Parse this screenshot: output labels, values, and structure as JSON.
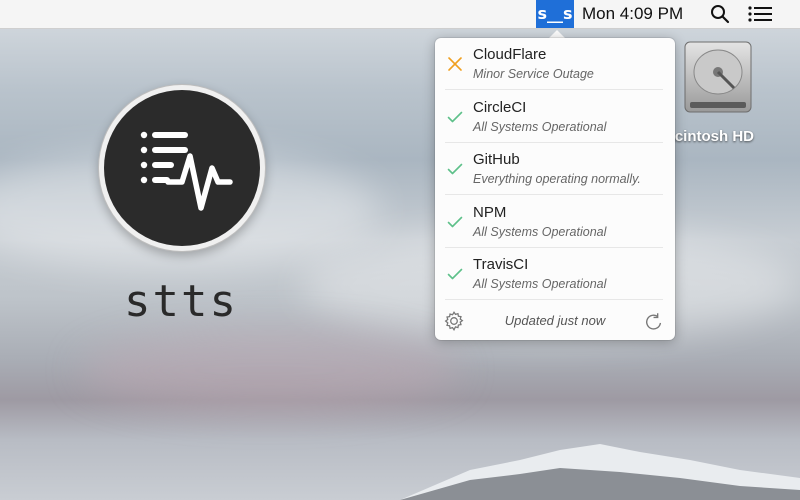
{
  "menubar": {
    "app_label": "s__s",
    "clock": "Mon 4:09 PM",
    "search_icon": "magnifier-icon",
    "list_icon": "list-icon"
  },
  "app": {
    "name": "stts",
    "logo_icon": "status-pulse-icon"
  },
  "desktop": {
    "disk_label": "Macintosh HD",
    "disk_icon": "hard-drive-icon"
  },
  "popover": {
    "services": [
      {
        "name": "CloudFlare",
        "status": "Minor Service Outage",
        "icon": "cross-icon",
        "color": "#f0a020"
      },
      {
        "name": "CircleCI",
        "status": "All Systems Operational",
        "icon": "check-icon",
        "color": "#5ec08a"
      },
      {
        "name": "GitHub",
        "status": "Everything operating normally.",
        "icon": "check-icon",
        "color": "#5ec08a"
      },
      {
        "name": "NPM",
        "status": "All Systems Operational",
        "icon": "check-icon",
        "color": "#5ec08a"
      },
      {
        "name": "TravisCI",
        "status": "All Systems Operational",
        "icon": "check-icon",
        "color": "#5ec08a"
      }
    ],
    "footer": {
      "updated_text": "Updated just now",
      "settings_icon": "gear-icon",
      "refresh_icon": "refresh-icon"
    }
  }
}
